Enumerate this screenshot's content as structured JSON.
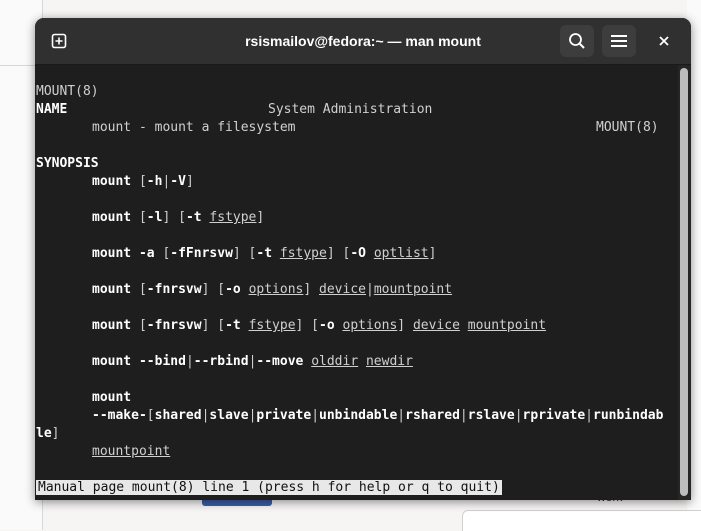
{
  "window": {
    "title": "rsismailov@fedora:~ — man mount"
  },
  "terminal": {
    "header_left": "MOUNT(8)",
    "header_center": "System Administration",
    "header_right": "MOUNT(8)",
    "name_heading": "NAME",
    "name_text": "mount - mount a filesystem",
    "synopsis_heading": "SYNOPSIS",
    "cmd": "mount",
    "s1": {
      "a": " [",
      "b": "-h",
      "c": "|",
      "d": "-V",
      "e": "]"
    },
    "s2": {
      "a": " [",
      "b": "-l",
      "c": "] [",
      "d": "-t",
      "e": " ",
      "f": "fstype",
      "g": "]"
    },
    "s3": {
      "a": " ",
      "b": "-a",
      "c": " [",
      "d": "-fFnrsvw",
      "e": "] [",
      "f": "-t",
      "g": " ",
      "h": "fstype",
      "i": "] [",
      "j": "-O",
      "k": " ",
      "l": "optlist",
      "m": "]"
    },
    "s4": {
      "a": " [",
      "b": "-fnrsvw",
      "c": "] [",
      "d": "-o",
      "e": " ",
      "f": "options",
      "g": "] ",
      "h": "device",
      "i": "|",
      "j": "mountpoint"
    },
    "s5": {
      "a": " [",
      "b": "-fnrsvw",
      "c": "] [",
      "d": "-t",
      "e": " ",
      "f": "fstype",
      "g": "] [",
      "h": "-o",
      "i": " ",
      "j": "options",
      "k": "] ",
      "l": "device",
      "m": " ",
      "n": "mountpoint"
    },
    "s6": {
      "a": " ",
      "b": "--bind",
      "c": "|",
      "d": "--rbind",
      "e": "|",
      "f": "--move",
      "g": " ",
      "h": "olddir",
      "i": " ",
      "j": "newdir"
    },
    "s7_cmd": "mount",
    "s7": {
      "a": "--make-",
      "b": "[",
      "c": "shared",
      "d": "|",
      "e": "slave",
      "f": "|",
      "g": "private",
      "h": "|",
      "i": "unbindable",
      "j": "|",
      "k": "rshared",
      "l": "|",
      "m": "rslave",
      "n": "|",
      "o": "rprivate",
      "p": "|",
      "q": "runbindab"
    },
    "s7_wrap": {
      "a": "le",
      "b": "]"
    },
    "s7_mp": "mountpoint",
    "status_line": "Manual page mount(8) line 1 (press h for help or q to quit)"
  },
  "background": {
    "partial_text": "work"
  }
}
